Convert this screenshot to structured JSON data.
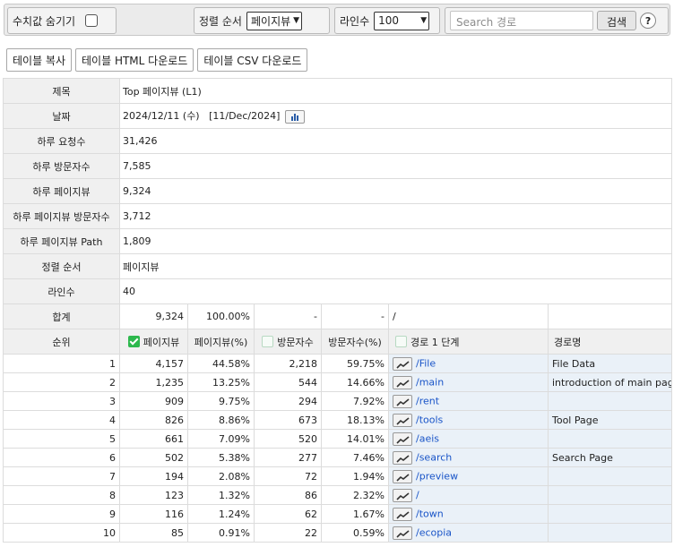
{
  "toolbar": {
    "hide_values_label": "수치값 숨기기",
    "sort_label": "정렬 순서",
    "sort_value": "페이지뷰",
    "lines_label": "라인수",
    "lines_value": "100",
    "search_placeholder": "Search 경로",
    "search_button": "검색",
    "help_button": "?"
  },
  "actions": {
    "copy": "테이블 복사",
    "html_download": "테이블 HTML 다운로드",
    "csv_download": "테이블 CSV 다운로드"
  },
  "summary": {
    "title_label": "제목",
    "title_value": "Top 페이지뷰 (L1)",
    "date_label": "날짜",
    "date_value": "2024/12/11 (수)   [11/Dec/2024]",
    "requests_label": "하루 요청수",
    "requests_value": "31,426",
    "visitors_label": "하루 방문자수",
    "visitors_value": "7,585",
    "pageviews_label": "하루 페이지뷰",
    "pageviews_value": "9,324",
    "pv_visitors_label": "하루 페이지뷰 방문자수",
    "pv_visitors_value": "3,712",
    "pv_path_label": "하루 페이지뷰 Path",
    "pv_path_value": "1,809",
    "sort_label": "정렬 순서",
    "sort_value": "페이지뷰",
    "lines_label": "라인수",
    "lines_value": "40"
  },
  "table": {
    "total": {
      "label": "합계",
      "pageviews": "9,324",
      "pageviews_pct": "100.00%",
      "visitors": "-",
      "visitors_pct": "-",
      "path": "/"
    },
    "headers": {
      "rank": "순위",
      "pageviews": "페이지뷰",
      "pageviews_pct": "페이지뷰(%)",
      "visitors": "방문자수",
      "visitors_pct": "방문자수(%)",
      "path": "경로 1 단계",
      "desc": "경로명"
    },
    "rows": [
      {
        "rank": "1",
        "pv": "4,157",
        "pvp": "44.58%",
        "vis": "2,218",
        "visp": "59.75%",
        "path": "/File",
        "desc": "File Data"
      },
      {
        "rank": "2",
        "pv": "1,235",
        "pvp": "13.25%",
        "vis": "544",
        "visp": "14.66%",
        "path": "/main",
        "desc": "introduction of main page"
      },
      {
        "rank": "3",
        "pv": "909",
        "pvp": "9.75%",
        "vis": "294",
        "visp": "7.92%",
        "path": "/rent",
        "desc": ""
      },
      {
        "rank": "4",
        "pv": "826",
        "pvp": "8.86%",
        "vis": "673",
        "visp": "18.13%",
        "path": "/tools",
        "desc": "Tool Page"
      },
      {
        "rank": "5",
        "pv": "661",
        "pvp": "7.09%",
        "vis": "520",
        "visp": "14.01%",
        "path": "/aeis",
        "desc": ""
      },
      {
        "rank": "6",
        "pv": "502",
        "pvp": "5.38%",
        "vis": "277",
        "visp": "7.46%",
        "path": "/search",
        "desc": "Search Page"
      },
      {
        "rank": "7",
        "pv": "194",
        "pvp": "2.08%",
        "vis": "72",
        "visp": "1.94%",
        "path": "/preview",
        "desc": ""
      },
      {
        "rank": "8",
        "pv": "123",
        "pvp": "1.32%",
        "vis": "86",
        "visp": "2.32%",
        "path": "/",
        "desc": ""
      },
      {
        "rank": "9",
        "pv": "116",
        "pvp": "1.24%",
        "vis": "62",
        "visp": "1.67%",
        "path": "/town",
        "desc": ""
      },
      {
        "rank": "10",
        "pv": "85",
        "pvp": "0.91%",
        "vis": "22",
        "visp": "0.59%",
        "path": "/ecopia",
        "desc": ""
      }
    ]
  },
  "colors": {
    "accent_check": "#2db84d",
    "link": "#1a55c8",
    "path_bg": "#eaf1f8"
  }
}
